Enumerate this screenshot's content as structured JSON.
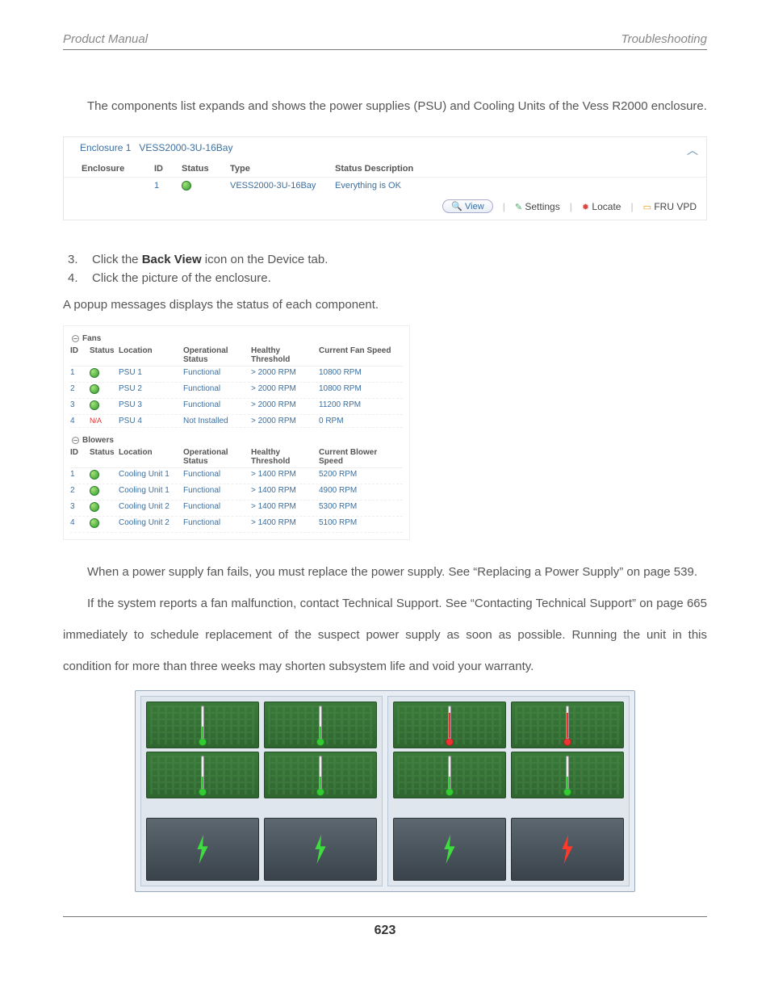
{
  "header": {
    "left": "Product Manual",
    "right": "Troubleshooting"
  },
  "intro": "The components list expands and shows the power supplies (PSU) and Cooling Units of the Vess R2000 enclosure.",
  "enclosure": {
    "title_prefix": "Enclosure 1",
    "title_model": "VESS2000-3U-16Bay",
    "headers": {
      "encl": "Enclosure",
      "id": "ID",
      "status": "Status",
      "type": "Type",
      "sd": "Status Description"
    },
    "row": {
      "id": "1",
      "type": "VESS2000-3U-16Bay",
      "sd": "Everything is OK"
    },
    "toolbar": {
      "view": "View",
      "settings": "Settings",
      "locate": "Locate",
      "fru": "FRU VPD"
    }
  },
  "steps": {
    "s3_pre": "Click the ",
    "s3_bold": "Back View",
    "s3_post": " icon on the Device tab.",
    "s4": "Click the picture of the enclosure."
  },
  "popup_line": "A popup messages displays the status of each component.",
  "fans": {
    "title": "Fans",
    "headers": {
      "id": "ID",
      "status": "Status",
      "loc": "Location",
      "op": "Operational Status",
      "th": "Healthy Threshold",
      "sp": "Current Fan Speed"
    },
    "rows": [
      {
        "id": "1",
        "loc": "PSU 1",
        "op": "Functional",
        "th": "> 2000 RPM",
        "sp": "10800 RPM",
        "status": "ok"
      },
      {
        "id": "2",
        "loc": "PSU 2",
        "op": "Functional",
        "th": "> 2000 RPM",
        "sp": "10800 RPM",
        "status": "ok"
      },
      {
        "id": "3",
        "loc": "PSU 3",
        "op": "Functional",
        "th": "> 2000 RPM",
        "sp": "11200 RPM",
        "status": "ok"
      },
      {
        "id": "4",
        "loc": "PSU 4",
        "op": "Not Installed",
        "th": "> 2000 RPM",
        "sp": "0 RPM",
        "status": "na"
      }
    ]
  },
  "blowers": {
    "title": "Blowers",
    "headers": {
      "id": "ID",
      "status": "Status",
      "loc": "Location",
      "op": "Operational Status",
      "th": "Healthy Threshold",
      "sp": "Current Blower Speed"
    },
    "rows": [
      {
        "id": "1",
        "loc": "Cooling Unit 1",
        "op": "Functional",
        "th": "> 1400 RPM",
        "sp": "5200 RPM",
        "status": "ok"
      },
      {
        "id": "2",
        "loc": "Cooling Unit 1",
        "op": "Functional",
        "th": "> 1400 RPM",
        "sp": "4900 RPM",
        "status": "ok"
      },
      {
        "id": "3",
        "loc": "Cooling Unit 2",
        "op": "Functional",
        "th": "> 1400 RPM",
        "sp": "5300 RPM",
        "status": "ok"
      },
      {
        "id": "4",
        "loc": "Cooling Unit 2",
        "op": "Functional",
        "th": "> 1400 RPM",
        "sp": "5100 RPM",
        "status": "ok"
      }
    ]
  },
  "para1": "When a power supply fan fails, you must replace the power supply. See “Replacing a Power Supply” on page 539.",
  "para2": "If the system reports a fan malfunction, contact Technical Support. See “Contacting Technical Support” on page 665 immediately to schedule replacement of the suspect power supply as soon as possible. Running the unit in this condition for more than three weeks may shorten subsystem life and void your warranty.",
  "page_number": "623",
  "na_label": "N/A"
}
